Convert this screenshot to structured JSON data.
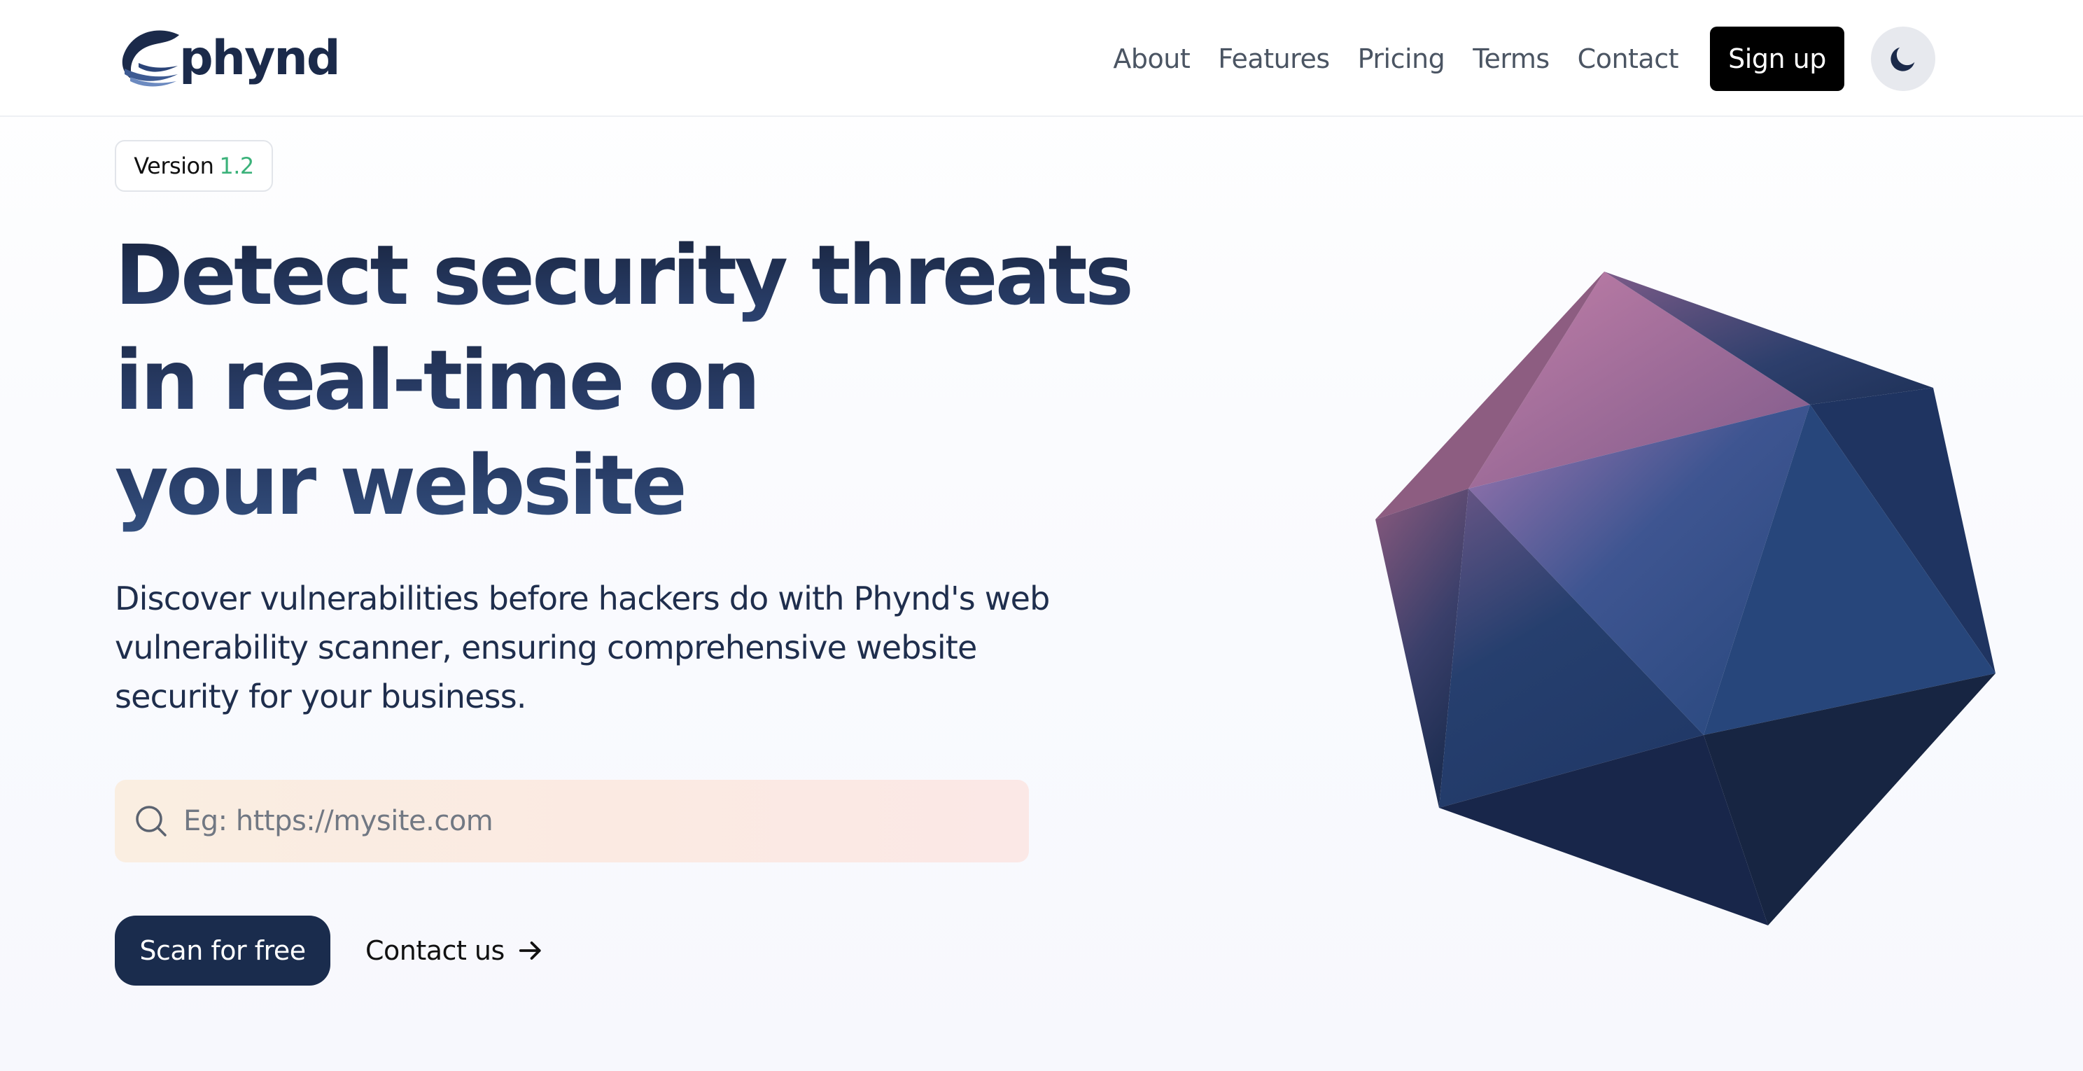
{
  "brand": {
    "name": "phynd"
  },
  "nav": {
    "items": [
      {
        "label": "About"
      },
      {
        "label": "Features"
      },
      {
        "label": "Pricing"
      },
      {
        "label": "Terms"
      },
      {
        "label": "Contact"
      }
    ],
    "signup_label": "Sign up",
    "theme_icon": "moon-icon"
  },
  "hero": {
    "badge_prefix": "Version",
    "badge_version": "1.2",
    "headline": {
      "line1": "Detect security threats",
      "line2": "in real-time on",
      "line3": "your website"
    },
    "subtitle": "Discover vulnerabilities before hackers do with Phynd's web vulnerability scanner, ensuring comprehensive website security for your business.",
    "search": {
      "placeholder": "Eg: https://mysite.com",
      "value": "",
      "icon": "search-icon"
    },
    "primary_cta": "Scan for free",
    "secondary_cta": "Contact us",
    "secondary_icon": "arrow-right-icon"
  },
  "colors": {
    "brand_navy": "#1a2c4d",
    "version_green": "#3bb27a",
    "highlight": "#e4f9fd",
    "signup_bg": "#000000"
  }
}
